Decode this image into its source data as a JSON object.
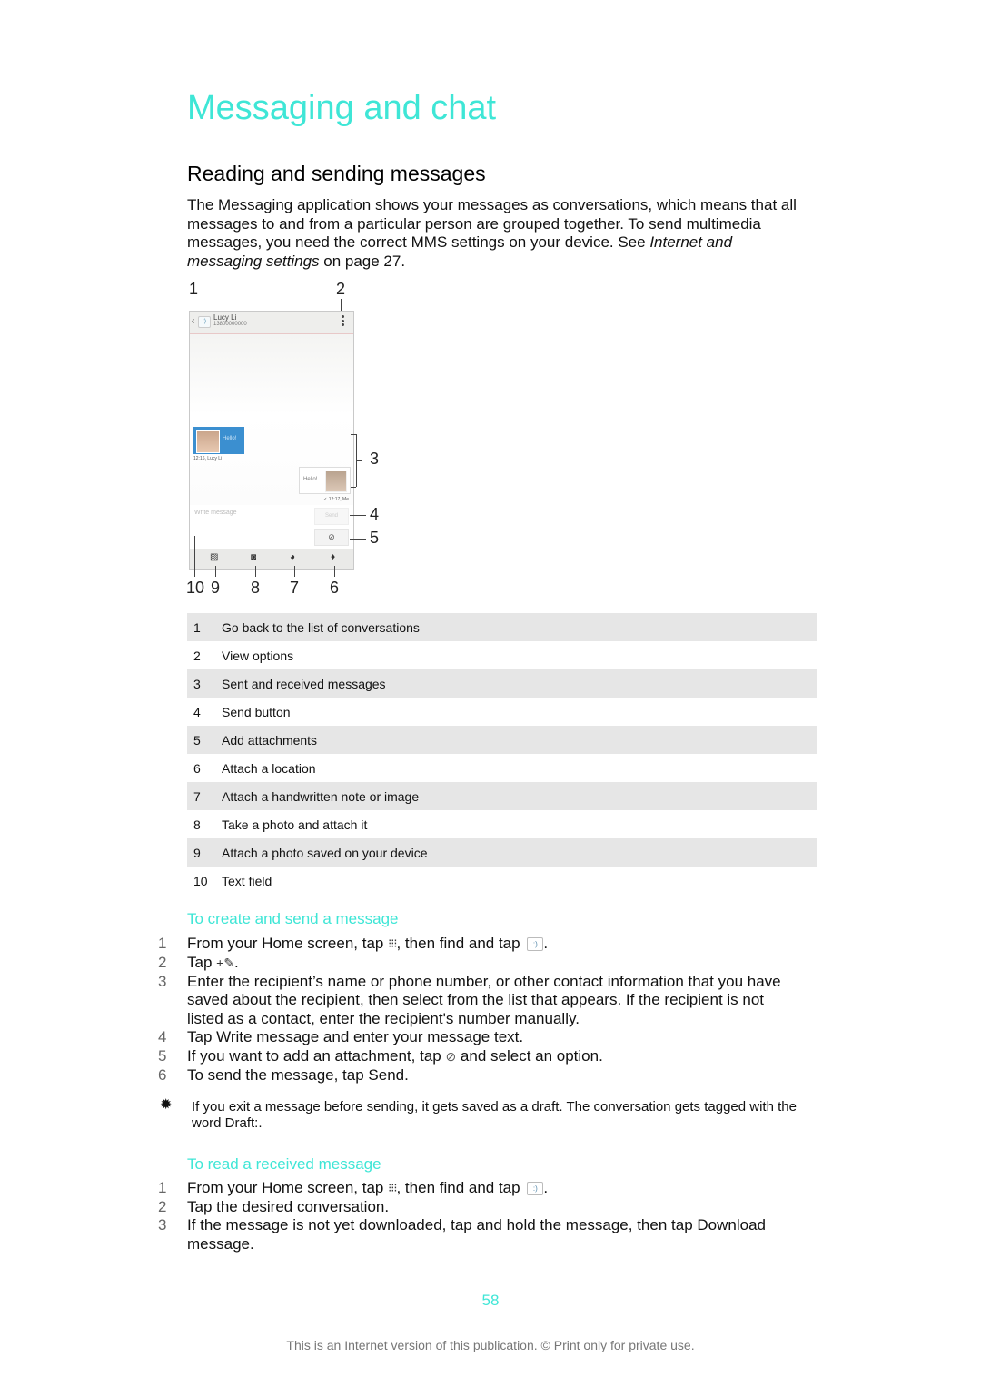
{
  "page": {
    "chapter_title": "Messaging and chat",
    "section_title": "Reading and sending messages",
    "intro": {
      "text": "The Messaging application shows your messages as conversations, which means that all messages to and from a particular person are grouped together. To send multimedia messages, you need the correct MMS settings on your device. See ",
      "link_text": "Internet and messaging settings",
      "after_link": " on page 27."
    },
    "accent_color": "#3fe6d6"
  },
  "figure": {
    "contact_name": "Lucy Li",
    "contact_number": "13800000000",
    "received_message": "Hello!",
    "received_timestamp": "12:16, Lucy Li",
    "sent_message": "Hello!",
    "sent_timestamp": "✓ 12:17, Me",
    "write_placeholder": "Write message",
    "send_label": "Send",
    "icons": {
      "back": "chevron-left",
      "menu": "more-vertical",
      "attach": "paperclip",
      "gallery": "image",
      "camera": "camera",
      "sketch": "handwriting",
      "location": "map-pin"
    },
    "callouts": [
      "1",
      "2",
      "3",
      "4",
      "5",
      "6",
      "7",
      "8",
      "9",
      "10"
    ]
  },
  "legend": [
    {
      "num": "1",
      "text": "Go back to the list of conversations"
    },
    {
      "num": "2",
      "text": "View options"
    },
    {
      "num": "3",
      "text": "Sent and received messages"
    },
    {
      "num": "4",
      "text": "Send button"
    },
    {
      "num": "5",
      "text": "Add attachments"
    },
    {
      "num": "6",
      "text": "Attach a location"
    },
    {
      "num": "7",
      "text": "Attach a handwritten note or image"
    },
    {
      "num": "8",
      "text": "Take a photo and attach it"
    },
    {
      "num": "9",
      "text": "Attach a photo saved on your device"
    },
    {
      "num": "10",
      "text": "Text field"
    }
  ],
  "create_section": {
    "title": "To create and send a message",
    "steps": [
      {
        "num": "1",
        "pre": "From your Home screen, tap ",
        "mid": ", then find and tap ",
        "post": "."
      },
      {
        "num": "2",
        "pre": "Tap ",
        "post": "."
      },
      {
        "num": "3",
        "text": "Enter the recipient’s name or phone number, or other contact information that you have saved about the recipient, then select from the list that appears. If the recipient is not listed as a contact, enter the recipient's number manually."
      },
      {
        "num": "4",
        "text": "Tap Write message and enter your message text."
      },
      {
        "num": "5",
        "pre": "If you want to add an attachment, tap ",
        "post": " and select an option."
      },
      {
        "num": "6",
        "text": "To send the message, tap Send."
      }
    ]
  },
  "tip": {
    "icon": "lightbulb",
    "text": "If you exit a message before sending, it gets saved as a draft. The conversation gets tagged with the word Draft:."
  },
  "read_section": {
    "title": "To read a received message",
    "steps": [
      {
        "num": "1",
        "pre": "From your Home screen, tap ",
        "mid": ", then find and tap ",
        "post": "."
      },
      {
        "num": "2",
        "text": "Tap the desired conversation."
      },
      {
        "num": "3",
        "text": "If the message is not yet downloaded, tap and hold the message, then tap Download message."
      }
    ]
  },
  "footer": {
    "page_number": "58",
    "notice": "This is an Internet version of this publication. © Print only for private use."
  }
}
